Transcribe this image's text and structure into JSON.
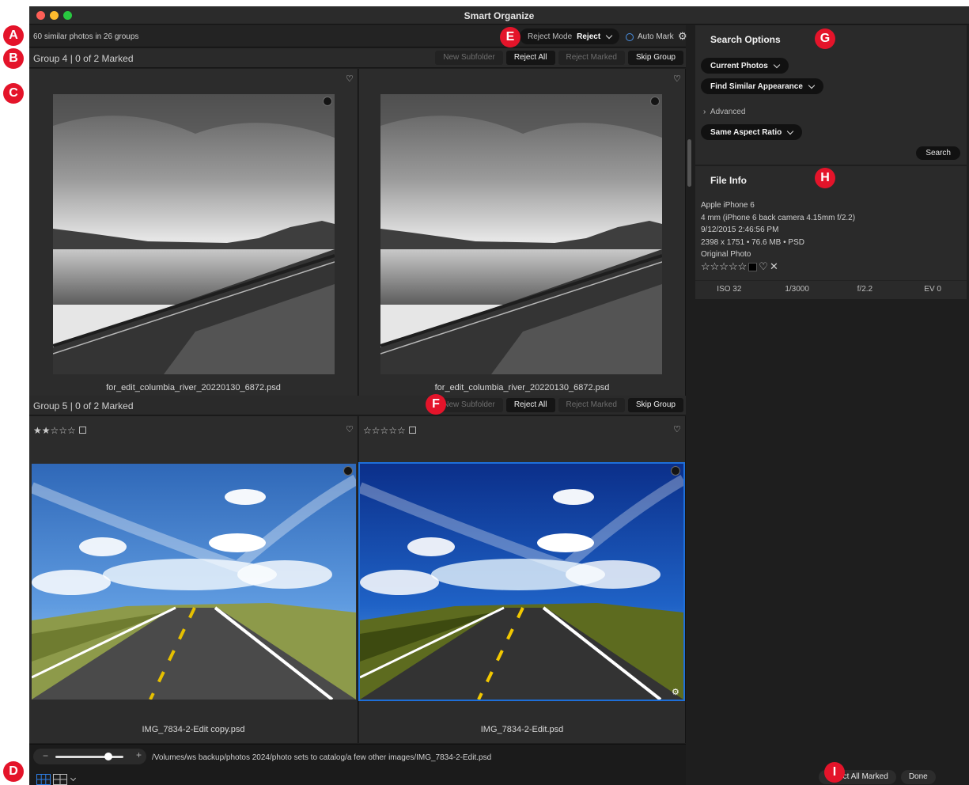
{
  "window": {
    "title": "Smart Organize"
  },
  "topbar": {
    "summary": "60 similar photos in 26 groups",
    "reject_mode_label": "Reject Mode",
    "reject_mode_value": "Reject",
    "auto_mark_label": "Auto Mark"
  },
  "group_buttons": {
    "new_subfolder": "New Subfolder",
    "reject_all": "Reject All",
    "reject_marked": "Reject Marked",
    "skip_group": "Skip Group"
  },
  "groups": [
    {
      "title": "Group 4 | 0 of 2 Marked",
      "photos": [
        {
          "filename": "for_edit_columbia_river_20220130_6872.psd"
        },
        {
          "filename": "for_edit_columbia_river_20220130_6872.psd"
        }
      ]
    },
    {
      "title": "Group 5 | 0 of 2 Marked",
      "photos": [
        {
          "filename": "IMG_7834-2-Edit copy.psd",
          "stars": "★★☆☆☆",
          "rating": 2
        },
        {
          "filename": "IMG_7834-2-Edit.psd",
          "stars": "☆☆☆☆☆",
          "rating": 0,
          "selected": true
        }
      ]
    }
  ],
  "bottombar": {
    "path": "/Volumes/ws backup/photos 2024/photo sets to catalog/a few other images/IMG_7834-2-Edit.psd",
    "zoom_level": 0.75
  },
  "search_options": {
    "title": "Search Options",
    "source": "Current Photos",
    "mode": "Find Similar Appearance",
    "advanced_label": "Advanced",
    "aspect": "Same Aspect Ratio",
    "search_button": "Search"
  },
  "file_info": {
    "title": "File Info",
    "camera": "Apple iPhone 6",
    "lens": "4 mm (iPhone 6 back camera 4.15mm f/2.2)",
    "date": "9/12/2015 2:46:56 PM",
    "dimensions": "2398 x 1751 • 76.6 MB • PSD",
    "source": "Original Photo",
    "stars": "☆☆☆☆☆",
    "iso": "ISO 32",
    "shutter": "1/3000",
    "aperture": "f/2.2",
    "ev": "EV 0"
  },
  "footer": {
    "reject_all_marked": "Reject All Marked",
    "done": "Done"
  },
  "callouts": [
    "A",
    "B",
    "C",
    "D",
    "E",
    "F",
    "G",
    "H",
    "I"
  ],
  "colors": {
    "accent_blue": "#1e6fd9",
    "callout_red": "#e4142a"
  }
}
